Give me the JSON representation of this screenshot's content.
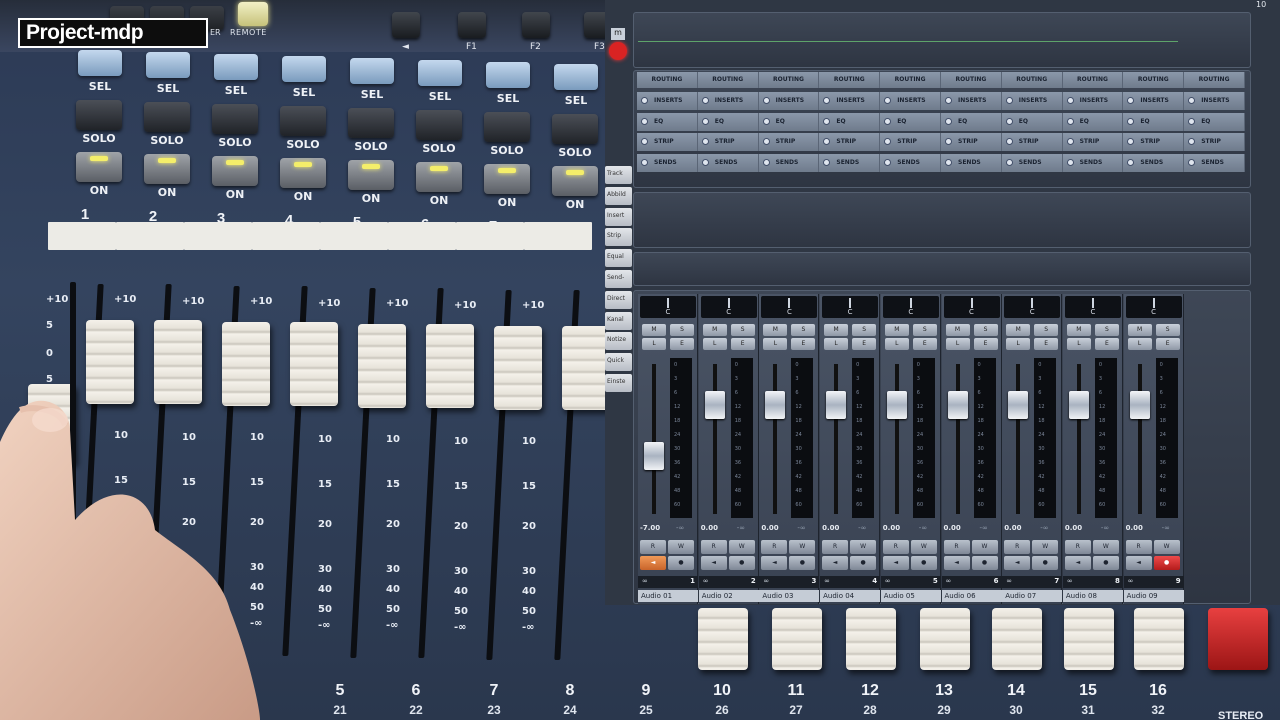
{
  "logo": {
    "text_a": "Pro",
    "text_b": "ject-mdp"
  },
  "hardware_top": {
    "er_label": "ER",
    "remote_label": "REMOTE",
    "fkeys": [
      "",
      "F1",
      "F2",
      "F3"
    ]
  },
  "hardware_strips": {
    "sel_label": "SEL",
    "solo_label": "SOLO",
    "on_label": "ON",
    "channel_numbers": [
      "1",
      "2",
      "3",
      "4",
      "5",
      "6",
      "7",
      "8"
    ],
    "scale_marks": [
      "+10",
      "5",
      "0",
      "5",
      "10",
      "15",
      "20",
      "30",
      "40",
      "50",
      "-∞"
    ]
  },
  "daw": {
    "side_tabs": [
      "Track",
      "Abbild",
      "Insert",
      "Strip",
      "Equal",
      "Send-",
      "Direct",
      "Kanal",
      "Notize",
      "Quick",
      "Einste"
    ],
    "routing_label": "ROUTING",
    "rack_rows": [
      "INSERTS",
      "EQ",
      "STRIP",
      "SENDS"
    ],
    "mixer_channels": [
      {
        "pan": "C",
        "volume": "-7.00",
        "inf": "-∞",
        "number": "1",
        "name": "Audio 01",
        "fader_level": 0.48
      },
      {
        "pan": "C",
        "volume": "0.00",
        "inf": "-∞",
        "number": "2",
        "name": "Audio 02",
        "fader_level": 0.82
      },
      {
        "pan": "C",
        "volume": "0.00",
        "inf": "-∞",
        "number": "3",
        "name": "Audio 03",
        "fader_level": 0.82
      },
      {
        "pan": "C",
        "volume": "0.00",
        "inf": "-∞",
        "number": "4",
        "name": "Audio 04",
        "fader_level": 0.82
      },
      {
        "pan": "C",
        "volume": "0.00",
        "inf": "-∞",
        "number": "5",
        "name": "Audio 05",
        "fader_level": 0.82
      },
      {
        "pan": "C",
        "volume": "0.00",
        "inf": "-∞",
        "number": "6",
        "name": "Audio 06",
        "fader_level": 0.82
      },
      {
        "pan": "C",
        "volume": "0.00",
        "inf": "-∞",
        "number": "7",
        "name": "Audio 07",
        "fader_level": 0.82
      },
      {
        "pan": "C",
        "volume": "0.00",
        "inf": "-∞",
        "number": "8",
        "name": "Audio 08",
        "fader_level": 0.82
      },
      {
        "pan": "C",
        "volume": "0.00",
        "inf": "-∞",
        "number": "9",
        "name": "Audio 09",
        "fader_level": 0.82
      }
    ],
    "button_labels": {
      "m": "M",
      "s": "S",
      "l": "L",
      "e": "E",
      "r": "R",
      "w": "W"
    },
    "meter_scale": [
      "0",
      "3",
      "6",
      "12",
      "18",
      "24",
      "30",
      "36",
      "42",
      "48",
      "60"
    ],
    "top_right_number": "10",
    "record_m": "m"
  },
  "bottom_strips": {
    "numbers": [
      "5",
      "6",
      "7",
      "8",
      "9",
      "10",
      "11",
      "12",
      "13",
      "14",
      "15",
      "16"
    ],
    "sub_numbers": [
      "21",
      "22",
      "23",
      "24",
      "25",
      "26",
      "27",
      "28",
      "29",
      "30",
      "31",
      "32"
    ],
    "stereo_label": "STEREO"
  },
  "colors": {
    "accent_led": "#f4ee6a",
    "record_red": "#d92323",
    "sel_blue": "#9ab8d8"
  }
}
